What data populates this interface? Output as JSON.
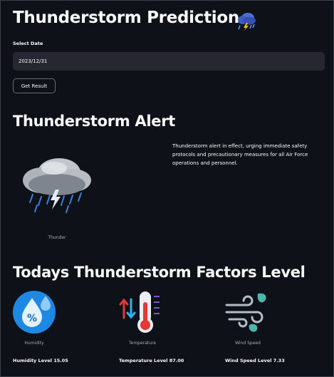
{
  "header": {
    "title": "Thunderstorm Prediction",
    "title_icon": "storm-cloud-emoji-icon"
  },
  "date_picker": {
    "label": "Select Date",
    "value": "2023/12/31"
  },
  "actions": {
    "get_result_label": "Get Result"
  },
  "alert": {
    "heading": "Thunderstorm Alert",
    "image_caption": "Thunder",
    "image_icon": "thunderstorm-cloud-icon",
    "message": "Thunderstorm alert in effect, urging immediate safety protocols and precautionary measures for all Air Force operations and personnel."
  },
  "factors": {
    "heading": "Todays Thunderstorm Factors Level",
    "items": [
      {
        "caption": "Humidity",
        "icon": "humidity-icon",
        "level_text": "Humidity Level 15.05",
        "value": 15.05
      },
      {
        "caption": "Temperature",
        "icon": "temperature-icon",
        "level_text": "Temperature Level 87.00",
        "value": 87.0
      },
      {
        "caption": "Wind Speed",
        "icon": "wind-icon",
        "level_text": "Wind Speed Level 7.33",
        "value": 7.33
      }
    ]
  },
  "colors": {
    "background": "#0e1117",
    "input_bg": "#262730",
    "humidity_blue": "#1e88e5",
    "thermo_red": "#e53935"
  }
}
